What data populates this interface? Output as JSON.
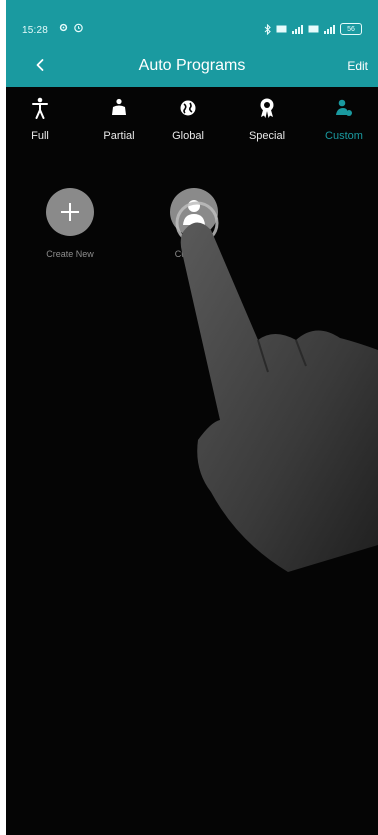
{
  "status_bar": {
    "time": "15:28",
    "battery": "56"
  },
  "header": {
    "title": "Auto Programs",
    "back_icon": "chevron-left-icon",
    "edit_label": "Edit"
  },
  "tabs": [
    {
      "label": "Full",
      "icon": "person-standing-icon",
      "active": false
    },
    {
      "label": "Partial",
      "icon": "person-partial-icon",
      "active": false
    },
    {
      "label": "Global",
      "icon": "globe-icon",
      "active": false
    },
    {
      "label": "Special",
      "icon": "medal-icon",
      "active": false
    },
    {
      "label": "Custom",
      "icon": "custom-person-icon",
      "active": true
    }
  ],
  "programs": [
    {
      "label": "Create New",
      "icon": "plus-icon"
    },
    {
      "label": "Custom 1",
      "icon": "person-icon"
    }
  ],
  "colors": {
    "accent": "#1a9aa0",
    "background": "#050505",
    "tile": "#8a8a8a",
    "inactive_text": "#e9e9e9"
  }
}
